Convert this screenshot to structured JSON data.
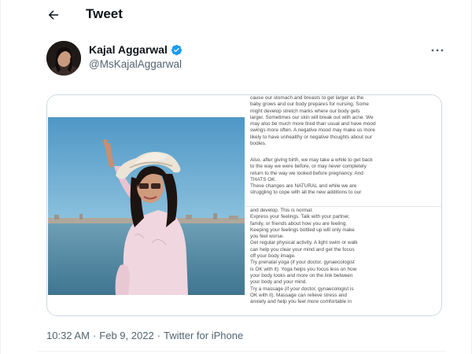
{
  "header": {
    "title": "Tweet"
  },
  "author": {
    "name": "Kajal Aggarwal",
    "handle": "@MsKajalAggarwal",
    "verified": true
  },
  "media_text": {
    "p_top": "cause our stomach and breasts to get larger as the\nbaby grows and our body prepares for nursing. Some\nmight develop stretch marks where our body gets\nlarger. Sometimes our skin will break out with acne. We\nmay also be much more tired than usual and have mood\nswings more often. A negative mood may make us more\nlikely to have unhealthy or negative thoughts about our\nbodies.",
    "p_after": "Also, after giving birth, we may take a while to get back\nto the way we were before, or may never completely\nreturn to the way we looked before pregnancy. And\nTHATS OK.\nThese changes are NATURAL and while we are\nstruggling to cope with all the new additions to our",
    "p_bottom": "and develop. This is normal.\nExpress your feelings. Talk with your partner,\nfamily, or friends about how you are feeling.\nKeeping your feelings bottled up will only make\nyou feel worse.\nGet regular physical activity. A light swim or walk\ncan help you clear your mind and get the focus\noff your body image.\nTry prenatal yoga (if your doctor, gynaecologist\nis OK with it). Yoga helps you focus less on how\nyour body looks and more on the link between\nyour body and your mind.\nTry a massage (if your doctor, gynaecologist is\nOK with it). Massage can relieve stress and\nanxiety and help you feel more comfortable in"
  },
  "meta": {
    "time": "10:32 AM",
    "date": "Feb 9, 2022",
    "source": "Twitter for iPhone",
    "sep": "·"
  },
  "colors": {
    "text": "#0f1419",
    "secondary": "#536471",
    "verified": "#1d9bf0",
    "border": "#cfd9de"
  },
  "icons": {
    "back": "arrow-left-icon",
    "verified": "verified-badge-icon",
    "more": "more-dots-icon"
  }
}
